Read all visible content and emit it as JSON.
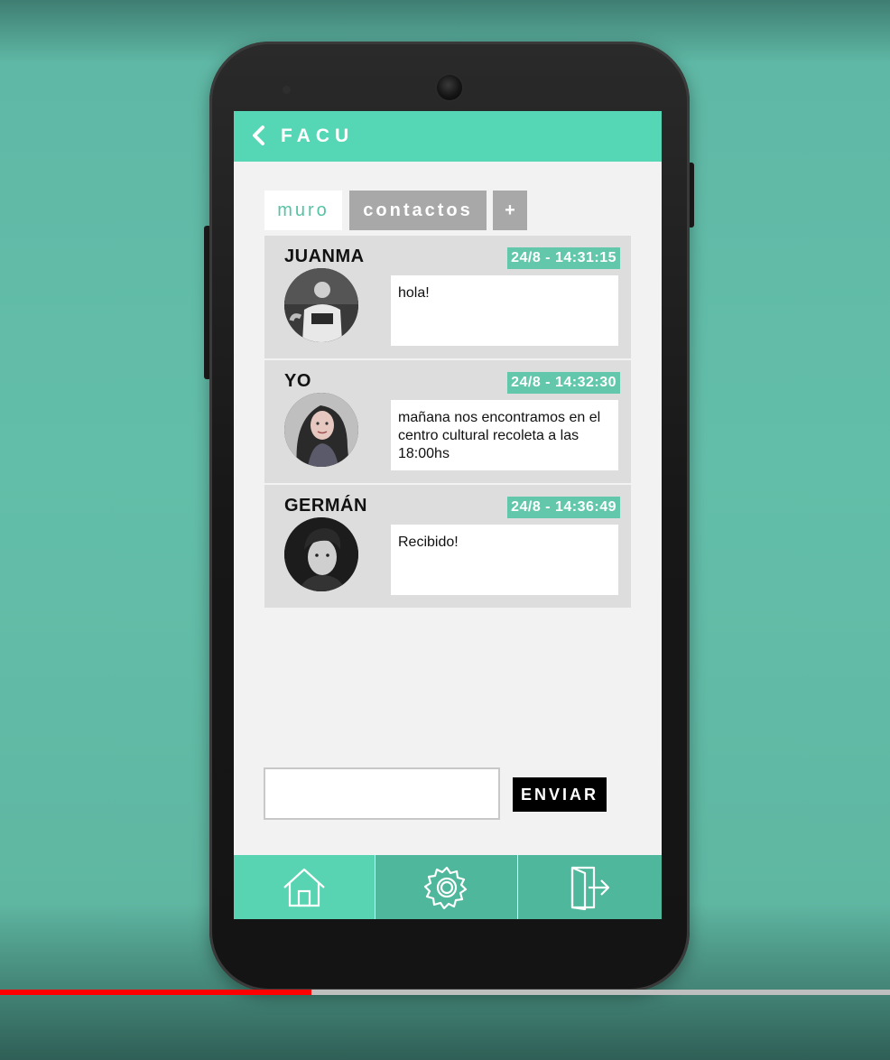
{
  "header": {
    "title": "FACU"
  },
  "tabs": {
    "wall": "muro",
    "contacts": "contactos",
    "add": "+"
  },
  "messages": [
    {
      "sender": "JUANMA",
      "time": "24/8 - 14:31:15",
      "text": "hola!"
    },
    {
      "sender": "YO",
      "time": "24/8 - 14:32:30",
      "text": "mañana nos encontramos en el centro cultural recoleta a las 18:00hs"
    },
    {
      "sender": "GERMÁN",
      "time": "24/8 - 14:36:49",
      "text": "Recibido!"
    }
  ],
  "composer": {
    "input_value": "",
    "send_label": "ENVIAR"
  },
  "nav": {
    "icons": [
      "home-icon",
      "gear-icon",
      "exit-door-icon"
    ]
  },
  "video_progress": {
    "percent": 35
  },
  "colors": {
    "accent": "#55d6b4",
    "accent_dark": "#4fb79c",
    "timestamp_bg": "#62c7ab",
    "progress": "#ff0000"
  }
}
